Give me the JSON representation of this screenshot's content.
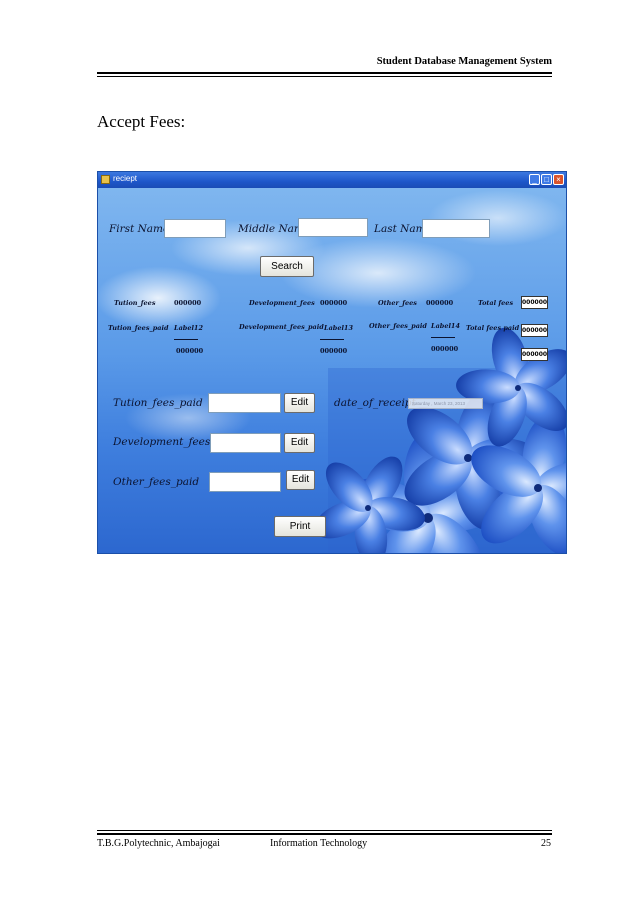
{
  "document": {
    "header_title": "Student Database Management System",
    "section_heading": "Accept Fees:",
    "footer_left": "T.B.G.Polytechnic, Ambajogai",
    "footer_center": "Information Technology",
    "footer_page": "25"
  },
  "window": {
    "title": "reciept",
    "controls": {
      "minimize": "_",
      "maximize": "□",
      "close": "×"
    }
  },
  "form": {
    "first_name_label": "First Name",
    "middle_name_label": "Middle Name",
    "last_name_label": "Last Name",
    "first_name_value": "",
    "middle_name_value": "",
    "last_name_value": "",
    "search_button": "Search",
    "fees": {
      "tution_fees_label": "Tution_fees",
      "tution_fees_value": "000000",
      "development_fees_label": "Development_fees",
      "development_fees_value": "000000",
      "other_fees_label": "Other_fees",
      "other_fees_value": "000000",
      "total_fees_label": "Total fees",
      "total_fees_value": "000000",
      "tution_fees_paid_label": "Tution_fees_paid",
      "tution_fees_paid_value": "Label12",
      "tution_fees_paid_amount": "000000",
      "development_fees_paid_label": "Development_fees_paid",
      "development_fees_paid_value": "Label13",
      "development_fees_paid_amount": "000000",
      "other_fees_paid_label": "Other_fees_paid",
      "other_fees_paid_value": "Label14",
      "other_fees_paid_amount": "000000",
      "total_fees_paid_label": "Total fees paid",
      "total_fees_paid_value": "000000",
      "total_fees_paid_amount": "000000"
    },
    "entry": {
      "tution_fees_paid_label": "Tution_fees_paid",
      "development_fees_paid_label": "Development_fees_paid.",
      "other_fees_paid_label": "Other_fees_paid",
      "tution_fees_paid_value": "",
      "development_fees_paid_value": "",
      "other_fees_paid_value": "",
      "edit_button": "Edit",
      "date_of_receipt_label": "date_of_receipt",
      "date_value": "Saturday , March 23, 2013"
    },
    "print_button": "Print"
  }
}
